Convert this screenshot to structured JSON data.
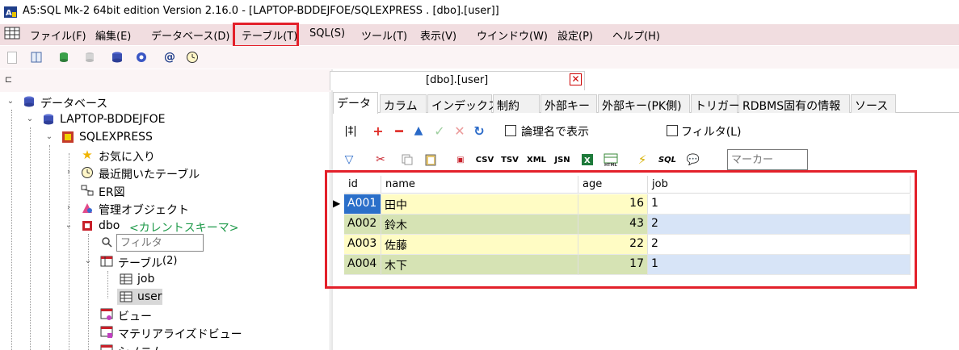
{
  "window": {
    "title": "A5:SQL Mk-2 64bit edition Version 2.16.0 - [LAPTOP-BDDEJFOE/SQLEXPRESS . [dbo].[user]]"
  },
  "menu": {
    "items": [
      {
        "label": "ファイル(F)"
      },
      {
        "label": "編集(E)"
      },
      {
        "label": "データベース(D)"
      },
      {
        "label": "テーブル(T)"
      },
      {
        "label": "SQL(S)"
      },
      {
        "label": "ツール(T)"
      },
      {
        "label": "表示(V)"
      },
      {
        "label": "ウインドウ(W)"
      },
      {
        "label": "設定(P)"
      },
      {
        "label": "ヘルプ(H)"
      }
    ]
  },
  "tree": {
    "root_label": "データベース",
    "server_label": "LAPTOP-BDDEJFOE",
    "instance_label": "SQLEXPRESS",
    "favorites_label": "お気に入り",
    "recent_label": "最近開いたテーブル",
    "er_label": "ER図",
    "admin_label": "管理オブジェクト",
    "schema_label": "dbo",
    "schema_current": "<カレントスキーマ>",
    "filter_placeholder": "フィルタ",
    "tables_label": "テーブル",
    "tables_count": "(2)",
    "table_job": "job",
    "table_user": "user",
    "views_label": "ビュー",
    "mviews_label": "マテリアライズドビュー",
    "synonyms_label": "シノニム"
  },
  "document": {
    "tab_label": "[dbo].[user]",
    "subtabs": [
      {
        "label": "データ"
      },
      {
        "label": "カラム"
      },
      {
        "label": "インデックス"
      },
      {
        "label": "制約"
      },
      {
        "label": "外部キー"
      },
      {
        "label": "外部キー(PK側)"
      },
      {
        "label": "トリガー"
      },
      {
        "label": "RDBMS固有の情報"
      },
      {
        "label": "ソース"
      }
    ],
    "show_logical_label": "論理名で表示",
    "filter_label": "フィルタ(L)",
    "marker_placeholder": "マーカー"
  },
  "grid": {
    "columns": [
      "id",
      "name",
      "age",
      "job"
    ],
    "rows": [
      {
        "id": "A001",
        "name": "田中",
        "age": "16",
        "job": "1"
      },
      {
        "id": "A002",
        "name": "鈴木",
        "age": "43",
        "job": "2"
      },
      {
        "id": "A003",
        "name": "佐藤",
        "age": "22",
        "job": "2"
      },
      {
        "id": "A004",
        "name": "木下",
        "age": "17",
        "job": "1"
      }
    ]
  },
  "colors": {
    "menubar": "#f1dde0",
    "highlight_red": "#e3202a",
    "row_odd": "#fffcc4",
    "row_even": "#d6e3b4",
    "job_even": "#d7e4f7",
    "selected_cell": "#2b6fc9"
  },
  "icons": {
    "add": "plus-icon",
    "delete": "minus-icon",
    "up": "triangle-up-icon",
    "commit": "check-icon",
    "cancel": "x-icon",
    "refresh": "refresh-icon"
  }
}
